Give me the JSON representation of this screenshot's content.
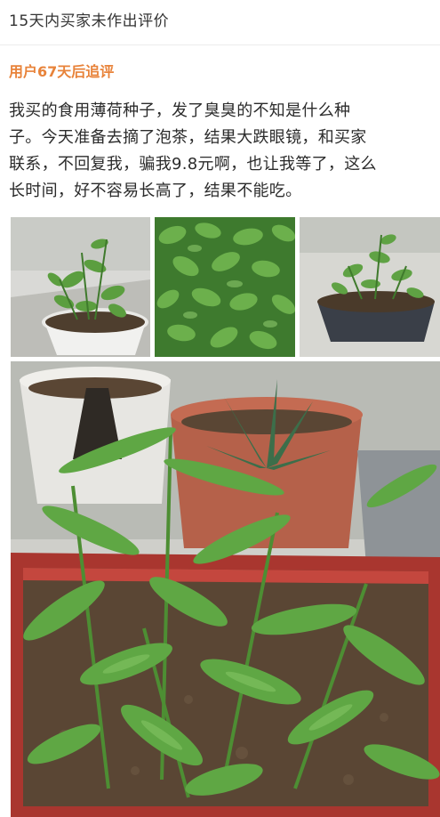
{
  "header": {
    "title": "15天内买家未作出评价"
  },
  "followup": {
    "label": "用户67天后追评"
  },
  "review": {
    "lines": [
      "我买的食用薄荷种子，发了臭臭的不知是什么种",
      "子。今天准备去摘了泡茶，结果大跌眼镜，和买家",
      "联系，不回复我，骗我9.8元啊，也让我等了，这么",
      "长时间，好不容易长高了，结果不能吃。"
    ]
  },
  "photos": [
    {
      "subject": "plant-in-white-pot"
    },
    {
      "subject": "dense-leaves-closeup"
    },
    {
      "subject": "plant-in-dark-pot"
    },
    {
      "subject": "plants-in-red-planter-box"
    }
  ],
  "colors": {
    "accent": "#e8833a",
    "text": "#2b2b2b",
    "leaf": "#4f9a3c",
    "leaf_dark": "#2f6e25",
    "soil": "#5a4634",
    "planter_red": "#b23a34"
  }
}
